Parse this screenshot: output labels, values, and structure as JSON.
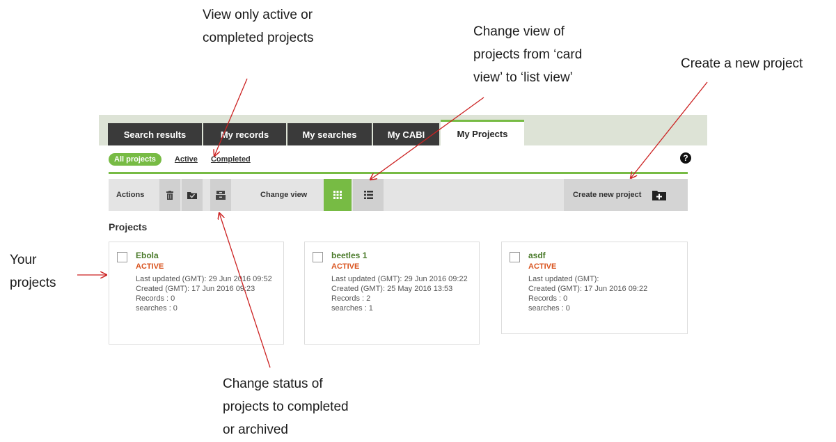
{
  "annotations": {
    "filter_note": [
      "View only active or",
      "completed projects"
    ],
    "view_note": [
      "Change view of",
      "projects from ‘card",
      "view’ to ‘list view’"
    ],
    "create_note": "Create a new project",
    "your_projects": [
      "Your",
      "projects"
    ],
    "status_note": [
      "Change status of",
      "projects to completed",
      "or archived"
    ]
  },
  "tabs": [
    "Search results",
    "My records",
    "My searches",
    "My CABI",
    "My Projects"
  ],
  "active_tab": "My Projects",
  "filters": {
    "all": "All projects",
    "active": "Active",
    "completed": "Completed"
  },
  "help_glyph": "?",
  "toolbar": {
    "actions_label": "Actions",
    "change_view_label": "Change view",
    "create_label": "Create new project",
    "icons": [
      "trash-icon",
      "folder-check-icon",
      "archive-icon",
      "grid-icon",
      "list-icon",
      "folder-plus-icon"
    ]
  },
  "projects_title": "Projects",
  "projects": [
    {
      "name": "Ebola",
      "status": "ACTIVE",
      "updated_label": "Last updated (GMT):",
      "updated": "29 Jun 2016 09:52",
      "created_label": "Created (GMT):",
      "created": "17 Jun 2016 09:23",
      "records": "Records : 0",
      "searches": "searches : 0"
    },
    {
      "name": "beetles 1",
      "status": "ACTIVE",
      "updated_label": "Last updated (GMT):",
      "updated": "29 Jun 2016 09:22",
      "created_label": "Created (GMT):",
      "created": "25 May 2016 13:53",
      "records": "Records : 2",
      "searches": "searches : 1"
    },
    {
      "name": "asdf",
      "status": "ACTIVE",
      "updated_label": "Last updated (GMT):",
      "updated": "",
      "created_label": "Created (GMT):",
      "created": "17 Jun 2016 09:22",
      "records": "Records : 0",
      "searches": "searches : 0"
    }
  ],
  "colors": {
    "accent_green": "#77bb44",
    "status_orange": "#d9531e",
    "tab_dark": "#3a3a3a",
    "arrow_red": "#cc2222"
  }
}
